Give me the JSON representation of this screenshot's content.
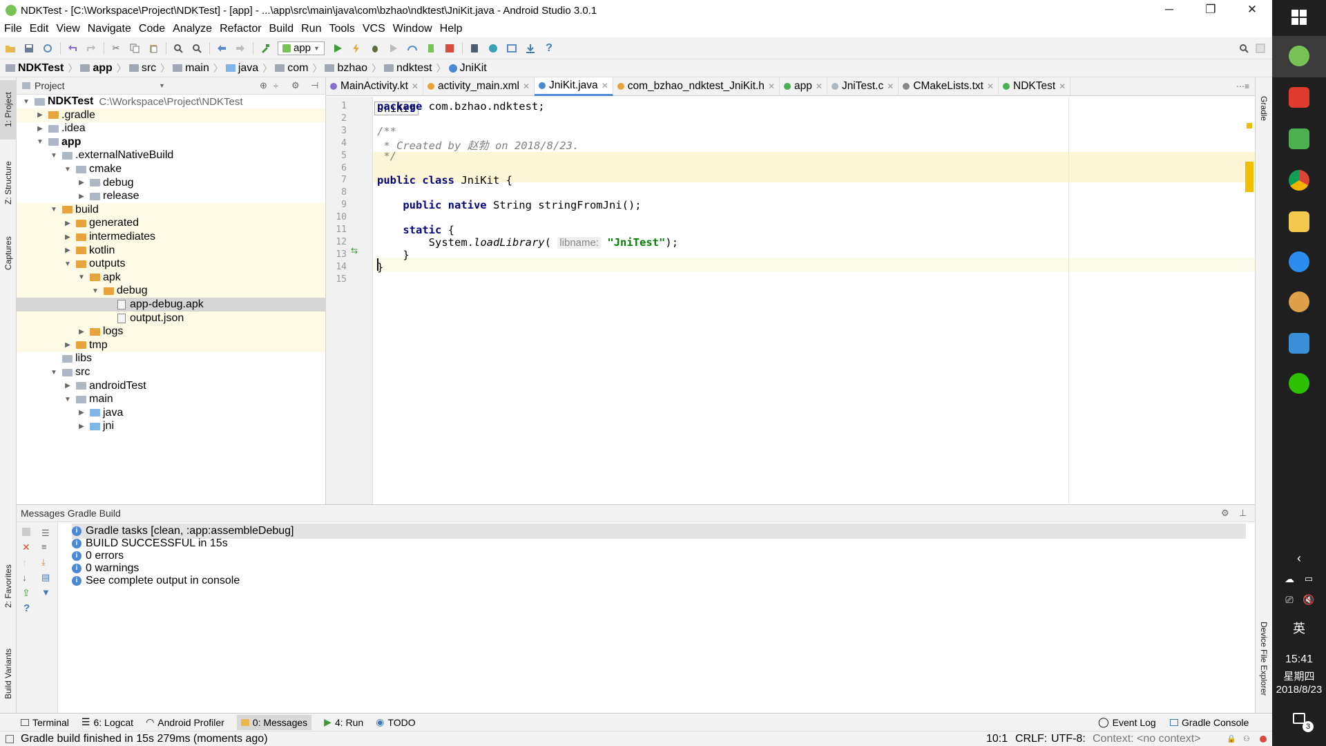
{
  "window": {
    "title": "NDKTest - [C:\\Workspace\\Project\\NDKTest] - [app] - ...\\app\\src\\main\\java\\com\\bzhao\\ndktest\\JniKit.java - Android Studio 3.0.1",
    "minimize": "─",
    "maximize": "❐",
    "close": "✕"
  },
  "menu": [
    "File",
    "Edit",
    "View",
    "Navigate",
    "Code",
    "Analyze",
    "Refactor",
    "Build",
    "Run",
    "Tools",
    "VCS",
    "Window",
    "Help"
  ],
  "toolbar": {
    "run_config": "app",
    "help": "?"
  },
  "breadcrumb": [
    "NDKTest",
    "app",
    "src",
    "main",
    "java",
    "com",
    "bzhao",
    "ndktest",
    "JniKit"
  ],
  "left_tool_tabs": [
    "1: Project",
    "Z: Structure",
    "Captures",
    "2: Favorites",
    "Build Variants"
  ],
  "right_tool_tabs": [
    "Gradle",
    "Device File Explorer"
  ],
  "project": {
    "header": "Project",
    "tree": [
      {
        "label": "NDKTest",
        "path": "C:\\Workspace\\Project\\NDKTest",
        "depth": 0,
        "expanded": true,
        "icon": "grey"
      },
      {
        "label": ".gradle",
        "depth": 1,
        "expanded": false,
        "icon": "orange"
      },
      {
        "label": ".idea",
        "depth": 1,
        "expanded": false,
        "icon": "grey"
      },
      {
        "label": "app",
        "depth": 1,
        "expanded": true,
        "icon": "grey"
      },
      {
        "label": ".externalNativeBuild",
        "depth": 2,
        "expanded": true,
        "icon": "grey"
      },
      {
        "label": "cmake",
        "depth": 3,
        "expanded": true,
        "icon": "grey"
      },
      {
        "label": "debug",
        "depth": 4,
        "expanded": false,
        "icon": "grey"
      },
      {
        "label": "release",
        "depth": 4,
        "expanded": false,
        "icon": "grey"
      },
      {
        "label": "build",
        "depth": 2,
        "expanded": true,
        "icon": "orange"
      },
      {
        "label": "generated",
        "depth": 3,
        "expanded": false,
        "icon": "orange"
      },
      {
        "label": "intermediates",
        "depth": 3,
        "expanded": false,
        "icon": "orange"
      },
      {
        "label": "kotlin",
        "depth": 3,
        "expanded": false,
        "icon": "orange"
      },
      {
        "label": "outputs",
        "depth": 3,
        "expanded": true,
        "icon": "orange"
      },
      {
        "label": "apk",
        "depth": 4,
        "expanded": true,
        "icon": "orange"
      },
      {
        "label": "debug",
        "depth": 5,
        "expanded": true,
        "icon": "orange"
      },
      {
        "label": "app-debug.apk",
        "depth": 6,
        "icon": "file",
        "selected": true
      },
      {
        "label": "output.json",
        "depth": 6,
        "icon": "file"
      },
      {
        "label": "logs",
        "depth": 4,
        "expanded": false,
        "icon": "orange"
      },
      {
        "label": "tmp",
        "depth": 3,
        "expanded": false,
        "icon": "orange"
      },
      {
        "label": "libs",
        "depth": 2,
        "icon": "grey"
      },
      {
        "label": "src",
        "depth": 2,
        "expanded": true,
        "icon": "grey"
      },
      {
        "label": "androidTest",
        "depth": 3,
        "expanded": false,
        "icon": "grey"
      },
      {
        "label": "main",
        "depth": 3,
        "expanded": true,
        "icon": "grey"
      },
      {
        "label": "java",
        "depth": 4,
        "expanded": false,
        "icon": "blue"
      },
      {
        "label": "jni",
        "depth": 4,
        "expanded": false,
        "icon": "blue"
      }
    ]
  },
  "editor_tabs": [
    {
      "label": "MainActivity.kt",
      "color": "#8a6fd1"
    },
    {
      "label": "activity_main.xml",
      "color": "#e8a33c"
    },
    {
      "label": "JniKit.java",
      "color": "#4a8ad4",
      "active": true
    },
    {
      "label": "com_bzhao_ndktest_JniKit.h",
      "color": "#e8a33c"
    },
    {
      "label": "app",
      "color": "#4caf50"
    },
    {
      "label": "JniTest.c",
      "color": "#aeb7c4"
    },
    {
      "label": "CMakeLists.txt",
      "color": "#888888"
    },
    {
      "label": "NDKTest",
      "color": "#4caf50"
    }
  ],
  "editor": {
    "breadcrumb_popup": "JniKit",
    "line_numbers": [
      "1",
      "2",
      "3",
      "4",
      "5",
      "6",
      "7",
      "8",
      "9",
      "10",
      "11",
      "12",
      "13",
      "14",
      "15"
    ],
    "code": {
      "l1_kw": "package",
      "l1_rest": " com.bzhao.ndktest;",
      "l3": "/**",
      "l4": " * Created by 赵勃 on 2018/8/23.",
      "l5": " */",
      "l7_kw": "public class",
      "l7_rest": " JniKit {",
      "l9_kw": "    public native",
      "l9_rest": " String stringFromJni();",
      "l11_kw": "    static",
      "l11_rest": " {",
      "l12_pre": "        System.",
      "l12_method": "loadLibrary",
      "l12_paren": "(",
      "l12_hint": "libname:",
      "l12_str": "\"JniTest\"",
      "l12_end": ");",
      "l13": "    }",
      "l14": "}"
    }
  },
  "messages": {
    "header": "Messages Gradle Build",
    "lines": [
      "Gradle tasks [clean, :app:assembleDebug]",
      "BUILD SUCCESSFUL in 15s",
      "0 errors",
      "0 warnings",
      "See complete output in console"
    ]
  },
  "bottom_tabs": [
    {
      "label": "Terminal"
    },
    {
      "label": "6: Logcat"
    },
    {
      "label": "Android Profiler"
    },
    {
      "label": "0: Messages",
      "selected": true
    },
    {
      "label": "4: Run"
    },
    {
      "label": "TODO"
    }
  ],
  "bottom_right_tabs": [
    "Event Log",
    "Gradle Console"
  ],
  "status": {
    "message": "Gradle build finished in 15s 279ms (moments ago)",
    "position": "10:1",
    "line_sep": "CRLF:",
    "encoding": "UTF-8:",
    "context": "Context: <no context>"
  },
  "taskbar": {
    "ime": "英",
    "time": "15:41",
    "weekday": "星期四",
    "date": "2018/8/23",
    "notif_count": "3"
  }
}
